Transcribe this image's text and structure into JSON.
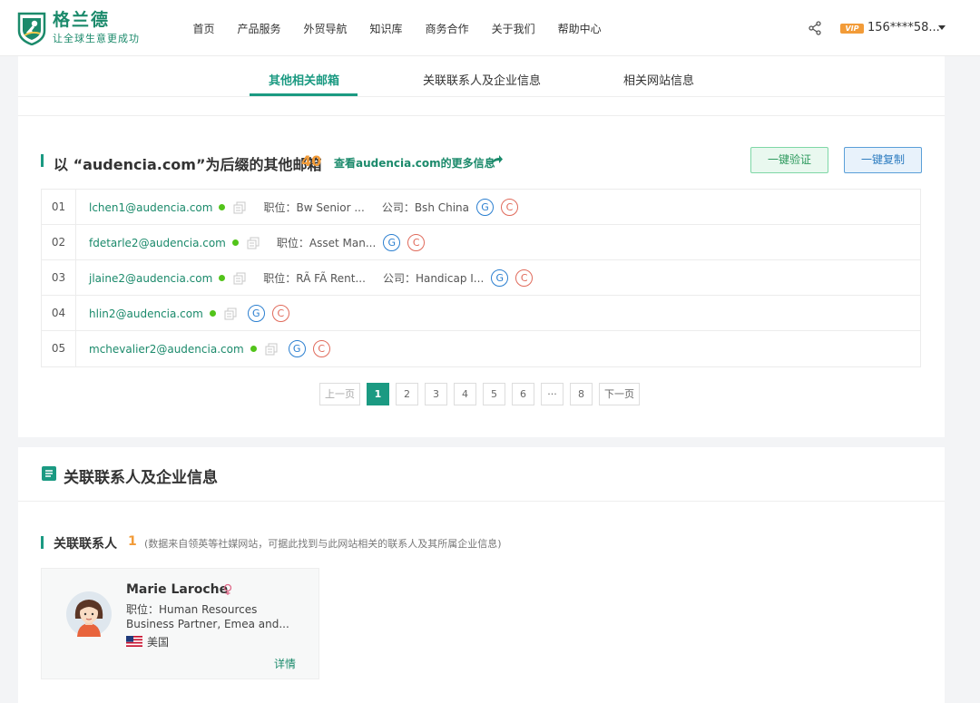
{
  "brand": {
    "name": "格兰德",
    "slogan": "让全球生意更成功"
  },
  "nav": [
    "首页",
    "产品服务",
    "外贸导航",
    "知识库",
    "商务合作",
    "关于我们",
    "帮助中心"
  ],
  "user": {
    "vip_label": "VIP",
    "phone": "156****58..."
  },
  "tabs": [
    "其他相关邮箱",
    "关联联系人及企业信息",
    "相关网站信息"
  ],
  "emails_section": {
    "title": "以 “audencia.com”为后缀的其他邮箱",
    "count": "40",
    "more_link": "查看audencia.com的更多信息",
    "verify_button": "一键验证",
    "copy_button": "一键复制",
    "position_label": "职位：",
    "company_label": "公司：",
    "badge_g": "G",
    "badge_c": "C",
    "rows": [
      {
        "num": "01",
        "email": "lchen1@audencia.com",
        "position": "Bw Senior ...",
        "company": "Bsh China"
      },
      {
        "num": "02",
        "email": "fdetarle2@audencia.com",
        "position": "Asset Man...",
        "company": ""
      },
      {
        "num": "03",
        "email": "jlaine2@audencia.com",
        "position": "RÃ FÃ Rent...",
        "company": "Handicap I..."
      },
      {
        "num": "04",
        "email": "hlin2@audencia.com",
        "position": "",
        "company": ""
      },
      {
        "num": "05",
        "email": "mchevalier2@audencia.com",
        "position": "",
        "company": ""
      }
    ]
  },
  "pagination": {
    "prev": "上一页",
    "pages": [
      "1",
      "2",
      "3",
      "4",
      "5",
      "6",
      "···",
      "8"
    ],
    "next": "下一页",
    "current": "1"
  },
  "contacts_section": {
    "title": "关联联系人及企业信息",
    "subtitle": "关联联系人",
    "count": "1",
    "note": "(数据来自领英等社媒网站，可据此找到与此网站相关的联系人及其所属企业信息)",
    "contact": {
      "name": "Marie Laroche",
      "position_line1": "职位：Human Resources",
      "position_line2": "Business Partner, Emea and...",
      "country": "美国",
      "detail_link": "详情"
    }
  },
  "colors": {
    "accent": "#1b9a82",
    "link": "#1b8a6b",
    "count": "#f29b38",
    "google": "#2b7fd0",
    "company": "#e06a5b"
  }
}
